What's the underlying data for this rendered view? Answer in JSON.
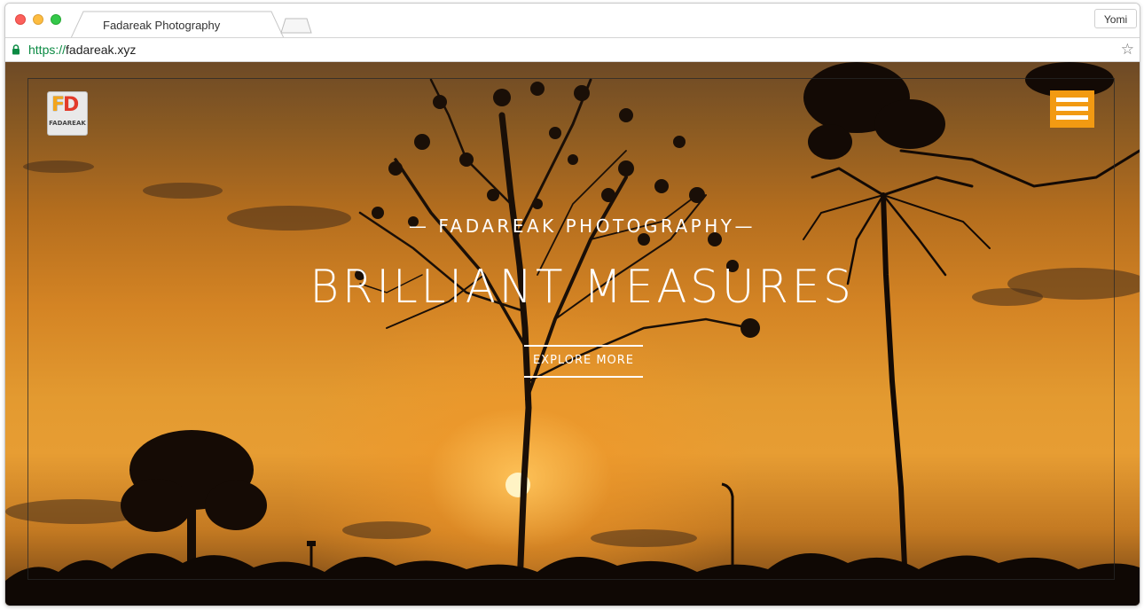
{
  "browser": {
    "tab_title": "Fadareak Photography",
    "profile_name": "Yomi",
    "url_scheme": "https://",
    "url_host": "fadareak.xyz",
    "star_icon": "☆"
  },
  "site": {
    "logo_mark_f": "F",
    "logo_mark_d": "D",
    "logo_text": "FADAREAK",
    "subtitle": "— FADAREAK PHOTOGRAPHY—",
    "title": "BRILLIANT MEASURES",
    "cta_label": "EXPLORE MORE",
    "menu_icon": "hamburger-menu-icon",
    "accent_color": "#f29a12"
  }
}
